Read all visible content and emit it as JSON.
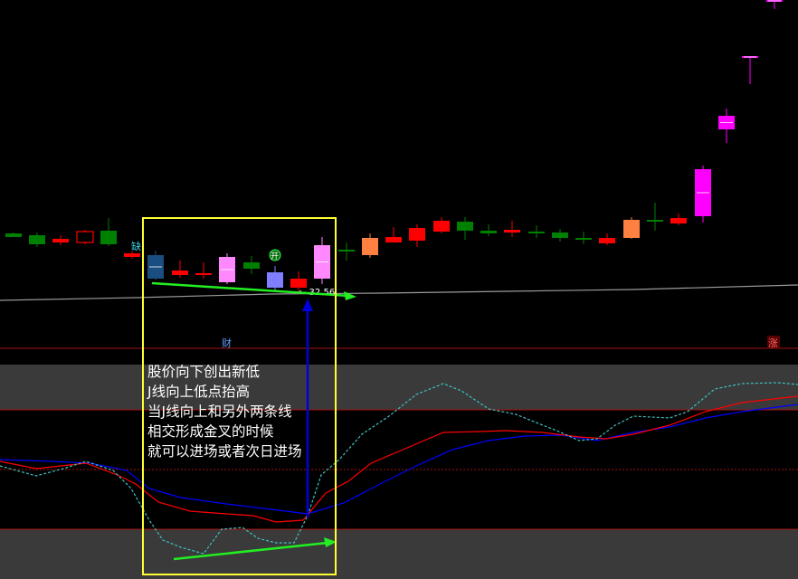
{
  "price_panel": {
    "marker_que": "缺",
    "marker_shi": "开",
    "marker_cai": "财",
    "marker_zhang": "涨",
    "price_label": "← 32.56"
  },
  "annotation": {
    "lines": [
      "股价向下创出新低",
      "J线向上低点抬高",
      "当J线向上和另外两条线",
      "相交形成金叉的时候",
      "就可以进场或者次日进场"
    ]
  },
  "colors": {
    "up_red": "#ff0000",
    "down_green": "#008000",
    "pink": "#ff88ff",
    "magenta": "#ff00ff",
    "orange": "#ff8040",
    "blue_candle": "#8080ff",
    "dark_blue": "#1a4d80",
    "highlight_box": "#ffff33",
    "arrow_green": "#22ee22",
    "arrow_blue": "#0000dd",
    "kdj_j": "#40c0c0",
    "kdj_k": "#ff0000",
    "kdj_d": "#0000ff",
    "divider": "#aa1111",
    "band": "#3a3a3a"
  }
}
